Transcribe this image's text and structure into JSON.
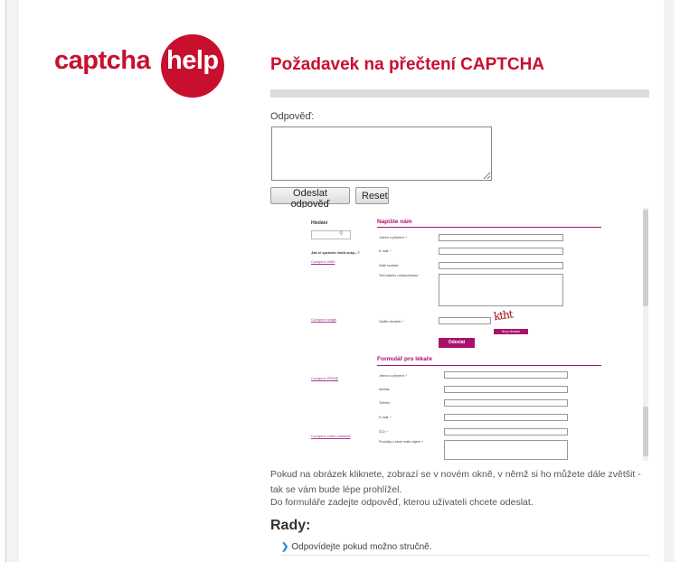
{
  "logo": {
    "left_text": "captcha",
    "right_text": "help"
  },
  "page_title": "Požadavek na přečtení CAPTCHA",
  "form": {
    "answer_label": "Odpověď:",
    "answer_value": "",
    "submit_label": "Odeslat odpověď",
    "reset_label": "Reset"
  },
  "captcha_image": {
    "sidebar_title": "Hledání",
    "sidebar_question": "Jak si správně čistit zuby...?",
    "links": [
      "Curaprox 5460",
      "Curaprox single",
      "Curaprox PRIME",
      "Curaprox zubní kartáček"
    ],
    "section1_title": "Napište nám",
    "section1_fields": [
      "Jméno a příjmení: *",
      "E-mail: *",
      "Další kontakt:",
      "Text vašeho vzkazu/dotazu:",
      "Opište obrázek: *"
    ],
    "captcha_text": "ktht",
    "new_image_label": "Nový obrázek",
    "send_label": "Odeslat",
    "section2_title": "Formulář pro lékaře",
    "section2_fields": [
      "Jméno a příjmení: *",
      "Adresa:",
      "Telefon:",
      "E-mail: *",
      "IČO: *",
      "Produkty o které máte zájem: *"
    ]
  },
  "instructions": {
    "p1": "Pokud na obrázek kliknete, zobrazí se v novém okně, v němž si ho můžete dále zvětšit - tak se vám bude lépe prohlížel.",
    "p2": "Do formuláře zadejte odpověď, kterou uživateli chcete odeslat."
  },
  "tips": {
    "title": "Rady:",
    "items": [
      "Odpovídejte pokud možno stručně."
    ]
  },
  "colors": {
    "brand": "#c8102e",
    "captcha_accent": "#a8126b",
    "tip_arrow": "#2a8bd6"
  }
}
